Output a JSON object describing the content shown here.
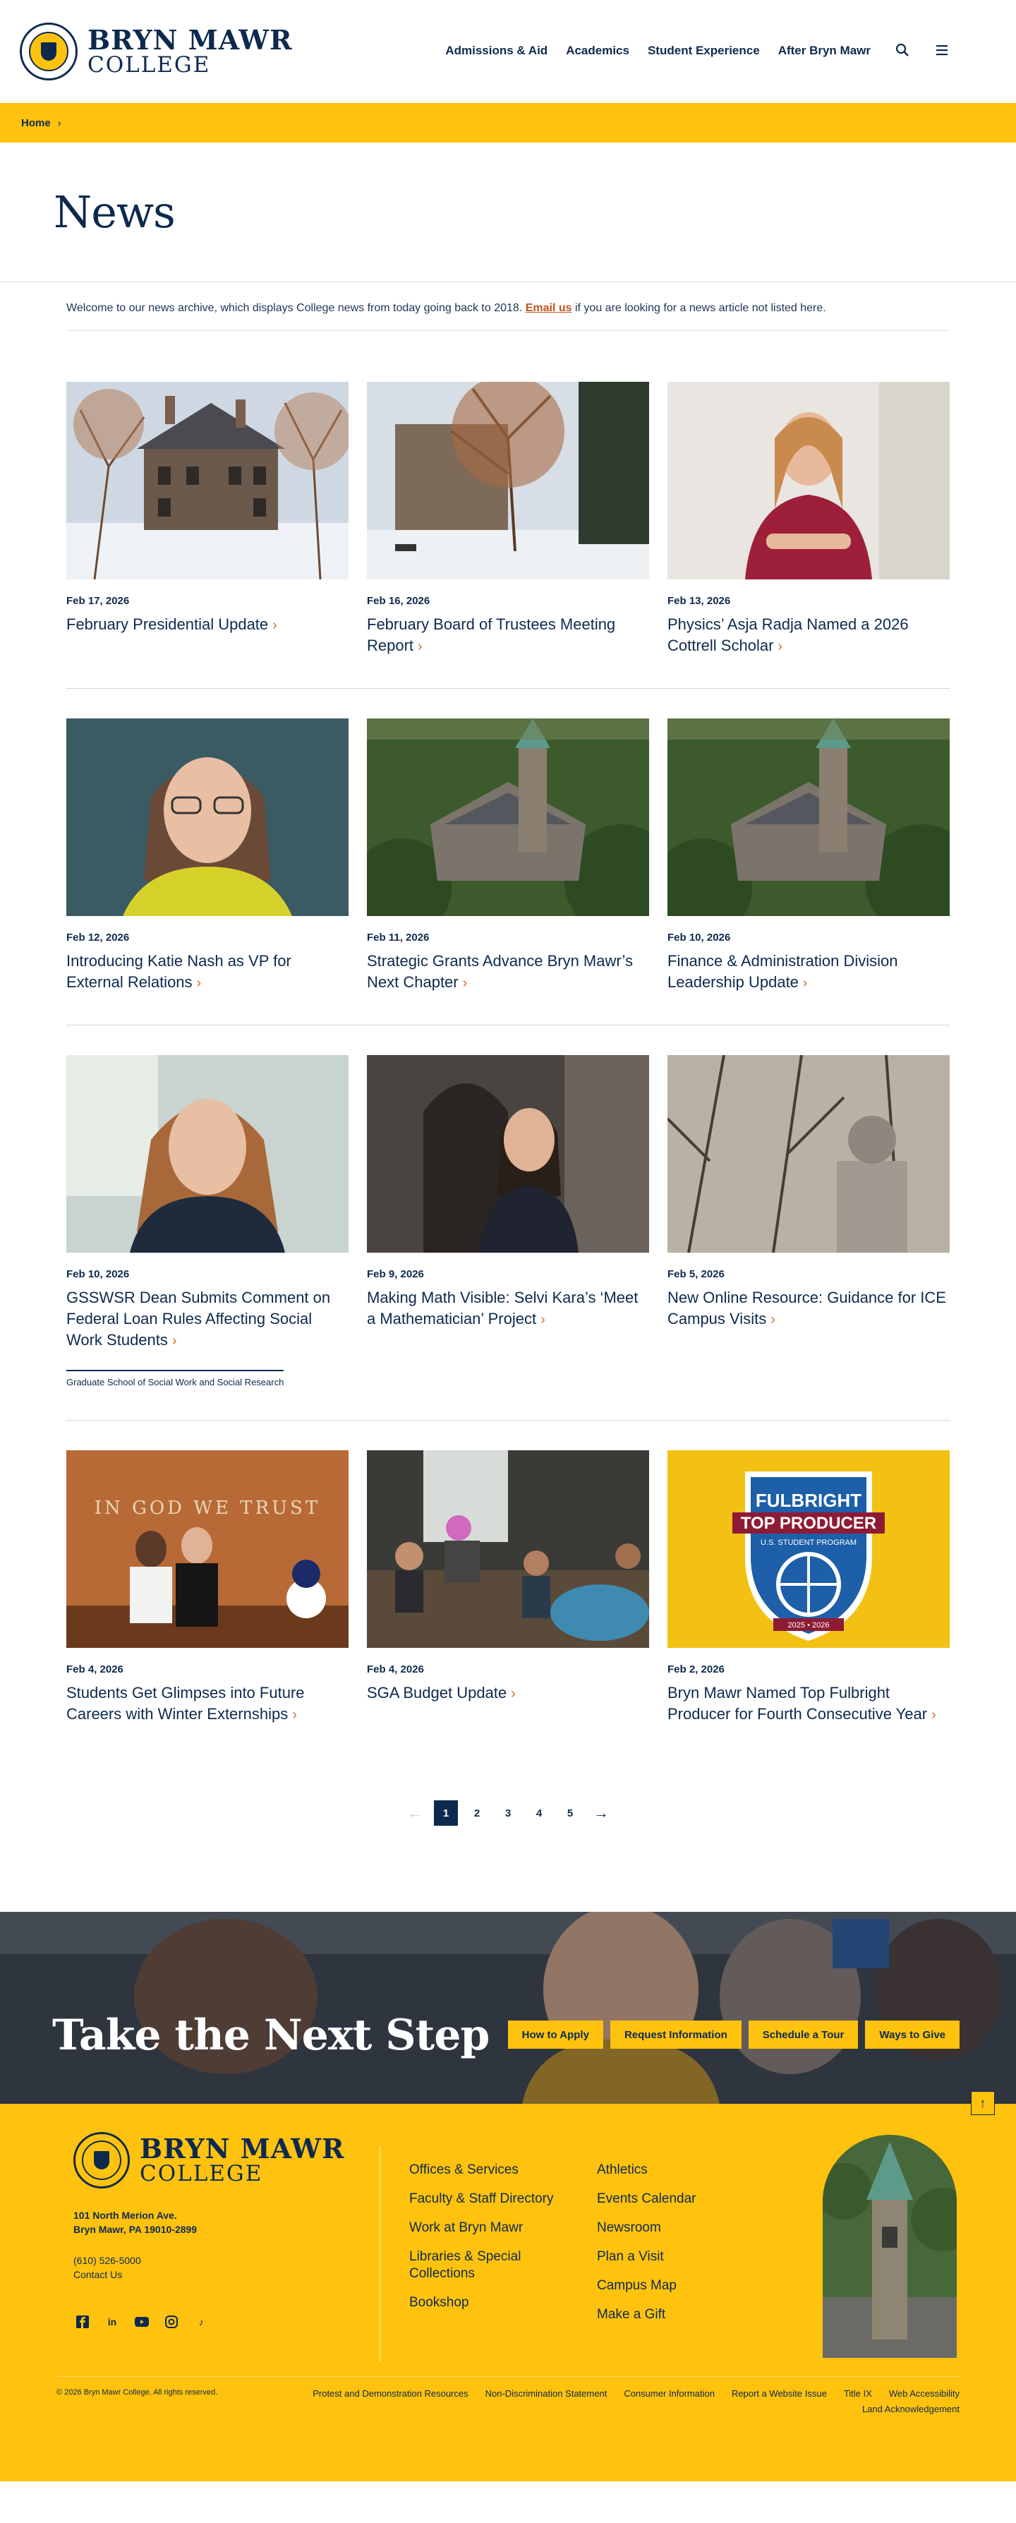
{
  "header": {
    "logo_line1": "BRYN MAWR",
    "logo_line2": "COLLEGE",
    "nav": [
      "Admissions & Aid",
      "Academics",
      "Student Experience",
      "After Bryn Mawr"
    ],
    "icons": [
      "search-icon",
      "menu-icon"
    ]
  },
  "breadcrumb": {
    "home": "Home",
    "separator": "›"
  },
  "page": {
    "title": "News",
    "intro_before": "Welcome to our news archive, which displays College news from today going back to 2018.",
    "intro_link": "Email us",
    "intro_after": "if you are looking for a news article not listed here."
  },
  "articles": [
    {
      "date": "Feb 17, 2026",
      "title": "February Presidential Update",
      "tag": ""
    },
    {
      "date": "Feb 16, 2026",
      "title": "February Board of Trustees Meeting Report",
      "tag": ""
    },
    {
      "date": "Feb 13, 2026",
      "title": "Physics’ Asja Radja Named a 2026 Cottrell Scholar",
      "tag": ""
    },
    {
      "date": "Feb 12, 2026",
      "title": "Introducing Katie Nash as VP for External Relations",
      "tag": ""
    },
    {
      "date": "Feb 11, 2026",
      "title": "Strategic Grants Advance Bryn Mawr’s Next Chapter",
      "tag": ""
    },
    {
      "date": "Feb 10, 2026",
      "title": "Finance & Administration Division Leadership Update",
      "tag": ""
    },
    {
      "date": "Feb 10, 2026",
      "title": "GSSWSR Dean Submits Comment on Federal Loan Rules Affecting Social Work Students",
      "tag": "Graduate School of Social Work and Social Research"
    },
    {
      "date": "Feb 9, 2026",
      "title": "Making Math Visible: Selvi Kara’s ‘Meet a Mathematician’ Project",
      "tag": ""
    },
    {
      "date": "Feb 5, 2026",
      "title": "New Online Resource: Guidance for ICE Campus Visits",
      "tag": ""
    },
    {
      "date": "Feb 4, 2026",
      "title": "Students Get Glimpses into Future Careers with Winter Externships",
      "tag": ""
    },
    {
      "date": "Feb 4, 2026",
      "title": "SGA Budget Update",
      "tag": ""
    },
    {
      "date": "Feb 2, 2026",
      "title": "Bryn Mawr Named Top Fulbright Producer for Fourth Consecutive Year",
      "tag": ""
    }
  ],
  "image_text": {
    "wall": "IN GOD WE TRUST",
    "fulbright_1": "FULBRIGHT",
    "fulbright_2": "TOP PRODUCER",
    "fulbright_3": "U.S. STUDENT PROGRAM",
    "fulbright_4": "2025 • 2026"
  },
  "pagination": {
    "pages": [
      "1",
      "2",
      "3",
      "4",
      "5"
    ],
    "current": "1",
    "prev": "←",
    "next": "→"
  },
  "cta": {
    "title": "Take the Next Step",
    "buttons": [
      "How to Apply",
      "Request Information",
      "Schedule a Tour",
      "Ways to Give"
    ]
  },
  "footer": {
    "address_1": "101 North Merion Ave.",
    "address_2": "Bryn Mawr, PA 19010-2899",
    "phone": "(610) 526-5000",
    "contact": "Contact Us",
    "social": [
      "facebook-icon",
      "linkedin-icon",
      "youtube-icon",
      "instagram-icon",
      "tiktok-icon"
    ],
    "col1": [
      "Offices & Services",
      "Faculty & Staff Directory",
      "Work at Bryn Mawr",
      "Libraries & Special Collections",
      "Bookshop"
    ],
    "col2": [
      "Athletics",
      "Events Calendar",
      "Newsroom",
      "Plan a Visit",
      "Campus Map",
      "Make a Gift"
    ],
    "copyright": "© 2026 Bryn Mawr College. All rights reserved.",
    "links": [
      "Protest and Demonstration Resources",
      "Non-Discrimination Statement",
      "Consumer Information",
      "Report a Website Issue",
      "Title IX",
      "Web Accessibility"
    ],
    "land": "Land Acknowledgement",
    "to_top": "↑"
  },
  "colors": {
    "navy": "#0d2a4e",
    "gold": "#ffc20e",
    "accent": "#d86a2e"
  }
}
